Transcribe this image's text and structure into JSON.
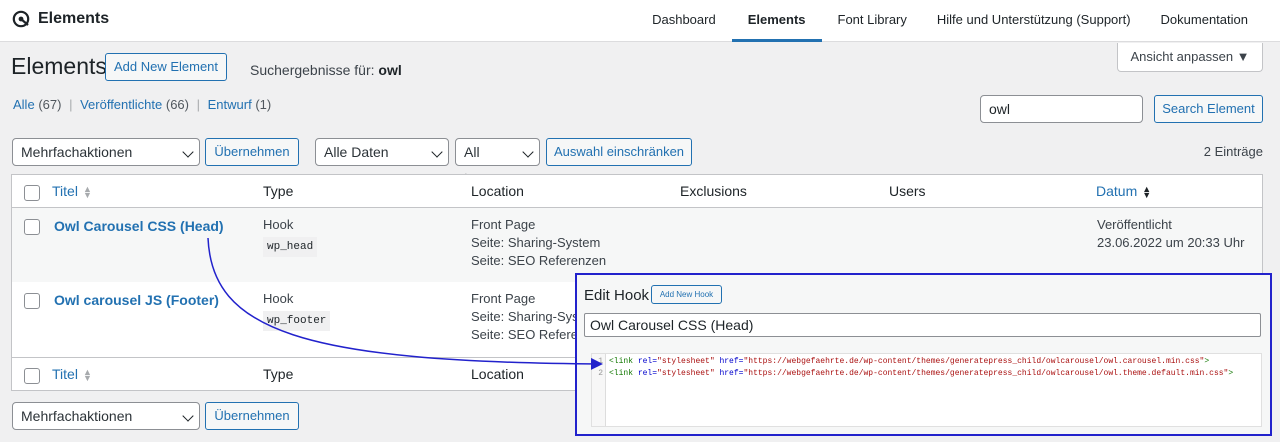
{
  "brand": {
    "title": "Elements",
    "icon": "elements-logo-icon"
  },
  "nav": [
    {
      "label": "Dashboard",
      "active": false
    },
    {
      "label": "Elements",
      "active": true
    },
    {
      "label": "Font Library",
      "active": false
    },
    {
      "label": "Hilfe und Unterstützung (Support)",
      "active": false
    },
    {
      "label": "Dokumentation",
      "active": false
    }
  ],
  "header": {
    "title": "Elements",
    "add_new_label": "Add New Element",
    "search_prefix": "Suchergebnisse für:",
    "search_term": "owl",
    "screen_options_label": "Ansicht anpassen ▼"
  },
  "filters": {
    "all_label": "Alle",
    "all_count": "(67)",
    "published_label": "Veröffentlichte",
    "published_count": "(66)",
    "draft_label": "Entwurf",
    "draft_count": "(1)",
    "sep": "|"
  },
  "search": {
    "value": "owl",
    "button_label": "Search Element"
  },
  "tablenav": {
    "bulk_label": "Mehrfachaktionen",
    "apply_label": "Übernehmen",
    "date_label": "Alle Daten",
    "types_label": "All types",
    "filter_button_label": "Auswahl einschränken",
    "count_label": "2 Einträge"
  },
  "columns": {
    "title": "Titel",
    "type": "Type",
    "location": "Location",
    "exclusions": "Exclusions",
    "users": "Users",
    "date": "Datum"
  },
  "rows": [
    {
      "title": "Owl Carousel CSS (Head)",
      "type": "Hook",
      "hook": "wp_head",
      "locations": [
        "Front Page",
        "Seite: Sharing-System",
        "Seite: SEO Referenzen"
      ],
      "status": "Veröffentlicht",
      "date": "23.06.2022 um 20:33 Uhr"
    },
    {
      "title": "Owl carousel JS (Footer)",
      "type": "Hook",
      "hook": "wp_footer",
      "locations": [
        "Front Page",
        "Seite: Sharing-Sys",
        "Seite: SEO Referen"
      ]
    }
  ],
  "overlay": {
    "title": "Edit Hook",
    "add_new_label": "Add New Hook",
    "element_title": "Owl Carousel CSS (Head)",
    "line_numbers": [
      "1",
      "2"
    ],
    "code": {
      "tag_open": "<link",
      "rel_attr": "rel=",
      "rel_val": "\"stylesheet\"",
      "href_attr": "href=",
      "line1_href": "\"https://webgefaehrte.de/wp-content/themes/generatepress_child/owlcarousel/owl.carousel.min.css\"",
      "line2_href": "\"https://webgefaehrte.de/wp-content/themes/generatepress_child/owlcarousel/owl.theme.default.min.css\"",
      "tag_close": ">"
    }
  },
  "colors": {
    "accent": "#2271b1",
    "annotation": "#2222cc"
  }
}
